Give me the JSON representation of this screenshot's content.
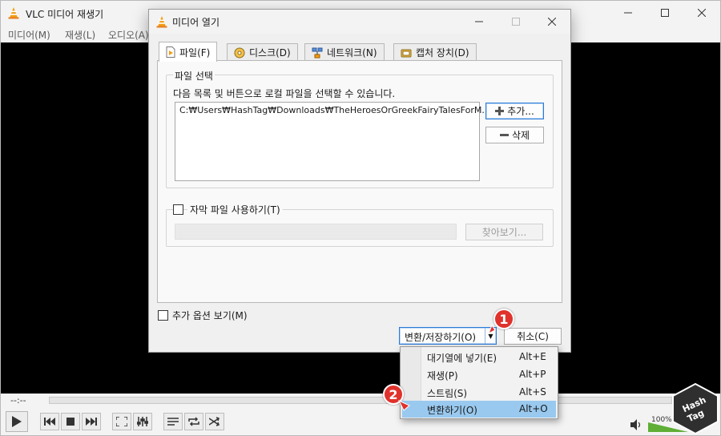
{
  "main_window": {
    "title": "VLC 미디어 재생기",
    "menu": [
      "미디어(M)",
      "재생(L)",
      "오디오(A)"
    ],
    "time_elapsed": "--:--",
    "volume_percent": "100%",
    "volume_level": 100
  },
  "dialog": {
    "title": "미디어 열기",
    "tabs": [
      "파일(F)",
      "디스크(D)",
      "네트워크(N)",
      "캡처 장치(D)"
    ],
    "file_group": {
      "title": "파일 선택",
      "description": "다음 목록 및 버튼으로 로컬 파일을 선택할 수 있습니다.",
      "entries": [
        "C:₩Users₩HashTag₩Downloads₩TheHeroesOrGreekFairyTalesForM..."
      ],
      "add_label": "추가...",
      "remove_label": "삭제"
    },
    "subtitle_group": {
      "checkbox_label": "자막 파일 사용하기(T)",
      "browse_label": "찾아보기..."
    },
    "more_options_label": "추가 옵션 보기(M)",
    "convert_save_label": "변환/저장하기(O)",
    "cancel_label": "취소(C)"
  },
  "dropdown": {
    "items": [
      {
        "label": "대기열에 넣기(E)",
        "shortcut": "Alt+E"
      },
      {
        "label": "재생(P)",
        "shortcut": "Alt+P"
      },
      {
        "label": "스트림(S)",
        "shortcut": "Alt+S"
      },
      {
        "label": "변환하기(O)",
        "shortcut": "Alt+O"
      }
    ]
  },
  "annotations": {
    "step1": "1",
    "step2": "2"
  },
  "logo": {
    "line1": "Hash",
    "line2": "Tag"
  },
  "colors": {
    "vlc_orange": "#f39c12",
    "badge_red": "#e0322c",
    "highlight_blue": "#99c9ef",
    "focus_blue": "#2b7bd6"
  }
}
